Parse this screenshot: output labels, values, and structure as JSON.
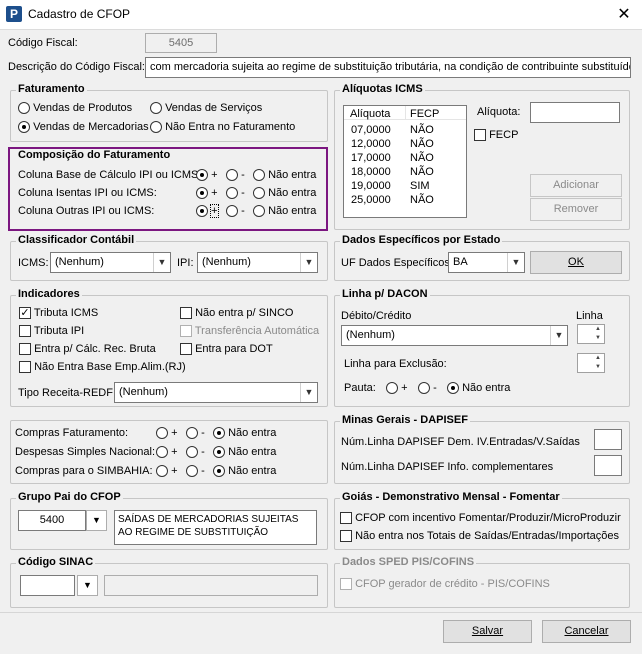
{
  "window": {
    "title": "Cadastro de CFOP",
    "app_letter": "P",
    "close": "✕"
  },
  "header": {
    "codigo_label": "Código Fiscal:",
    "codigo_value": "5405",
    "descricao_label": "Descrição do Código Fiscal:",
    "descricao_value": "com mercadoria sujeita ao regime de substituição tributária, na condição de contribuinte substituído"
  },
  "faturamento": {
    "title": "Faturamento",
    "options": [
      "Vendas de Produtos",
      "Vendas de Serviços",
      "Vendas de Mercadorias",
      "Não Entra no Faturamento"
    ],
    "selected": "Vendas de Mercadorias"
  },
  "composicao": {
    "title": "Composição do Faturamento",
    "rows": [
      {
        "label": "Coluna Base de Cálculo IPI ou ICMS:",
        "selected": "+"
      },
      {
        "label": "Coluna Isentas IPI ou ICMS:",
        "selected": "+"
      },
      {
        "label": "Coluna Outras IPI ou ICMS:",
        "selected": "+"
      }
    ],
    "opt_plus": "+",
    "opt_minus": "-",
    "opt_none": "Não entra"
  },
  "aliquotas": {
    "title": "Alíquotas ICMS",
    "col1": "Alíquota",
    "col2": "FECP",
    "rows": [
      {
        "aliquota": "07,0000",
        "fecp": "NÃO"
      },
      {
        "aliquota": "12,0000",
        "fecp": "NÃO"
      },
      {
        "aliquota": "17,0000",
        "fecp": "NÃO"
      },
      {
        "aliquota": "18,0000",
        "fecp": "NÃO"
      },
      {
        "aliquota": "19,0000",
        "fecp": "SIM"
      },
      {
        "aliquota": "25,0000",
        "fecp": "NÃO"
      }
    ],
    "aliquota_label": "Alíquota:",
    "aliquota_value": "",
    "fecp_label": "FECP",
    "adicionar": "Adicionar",
    "remover": "Remover"
  },
  "classificador": {
    "title": "Classificador Contábil",
    "icms_label": "ICMS:",
    "icms_value": "(Nenhum)",
    "ipi_label": "IPI:",
    "ipi_value": "(Nenhum)"
  },
  "dados_estado": {
    "title": "Dados Específicos por Estado",
    "uf_label": "UF Dados Específicos:",
    "uf_value": "BA",
    "ok": "OK"
  },
  "indicadores": {
    "title": "Indicadores",
    "items": [
      {
        "label": "Tributa ICMS",
        "checked": true
      },
      {
        "label": "Tributa IPI",
        "checked": false
      },
      {
        "label": "Entra p/ Cálc. Rec. Bruta",
        "checked": false
      },
      {
        "label": "Não Entra Base Emp.Alim.(RJ)",
        "checked": false
      },
      {
        "label": "Não entra p/ SINCO",
        "checked": false
      },
      {
        "label": "Transferência Automática",
        "checked": false
      },
      {
        "label": "Entra para DOT",
        "checked": false
      }
    ],
    "tipo_label": "Tipo Receita-REDF:",
    "tipo_value": "(Nenhum)"
  },
  "dacon": {
    "title": "Linha p/ DACON",
    "debito_label": "Débito/Crédito",
    "debito_value": "(Nenhum)",
    "linha_label": "Linha",
    "exclusao_label": "Linha para Exclusão:",
    "pauta_label": "Pauta:",
    "selected": "Não entra"
  },
  "compras": {
    "rows": [
      {
        "label": "Compras Faturamento:",
        "selected": "Não entra"
      },
      {
        "label": "Despesas Simples Nacional:",
        "selected": "Não entra"
      },
      {
        "label": "Compras para o SIMBAHIA:",
        "selected": "Não entra"
      }
    ]
  },
  "minas": {
    "title": "Minas Gerais - DAPISEF",
    "row1": "Núm.Linha DAPISEF Dem. IV.Entradas/V.Saídas",
    "row2": "Núm.Linha DAPISEF Info. complementares"
  },
  "grupo_pai": {
    "title": "Grupo Pai do CFOP",
    "code": "5400",
    "desc_line1": "SAÍDAS DE MERCADORIAS SUJEITAS",
    "desc_line2": "AO REGIME DE SUBSTITUIÇÃO"
  },
  "goias": {
    "title": "Goiás - Demonstrativo Mensal - Fomentar",
    "item1": "CFOP com incentivo  Fomentar/Produzir/MicroProduzir",
    "item2": "Não entra nos Totais de  Saídas/Entradas/Importações"
  },
  "sinac": {
    "title": "Código SINAC",
    "code": "",
    "desc": ""
  },
  "sped": {
    "title": "Dados SPED PIS/COFINS",
    "item1": "CFOP gerador de crédito - PIS/COFINS"
  },
  "footer": {
    "salvar": "Salvar",
    "cancelar": "Cancelar"
  }
}
